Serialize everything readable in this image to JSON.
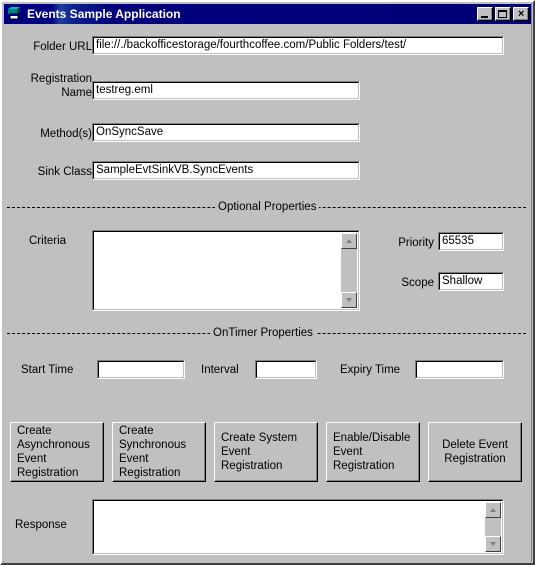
{
  "window": {
    "title": "Events Sample Application",
    "icon": "vb-form-icon",
    "controls": {
      "minimize": "_",
      "maximize": "□",
      "close": "×"
    }
  },
  "form": {
    "folder_url": {
      "label": "Folder URL",
      "value": "file://./backofficestorage/fourthcoffee.com/Public Folders/test/"
    },
    "registration_name": {
      "label": "Registration\nName",
      "value": "testreg.eml"
    },
    "methods": {
      "label": "Method(s)",
      "value": "OnSyncSave"
    },
    "sink_class": {
      "label": "Sink Class",
      "value": "SampleEvtSinkVB.SyncEvents"
    }
  },
  "optional_properties": {
    "caption": "Optional Properties",
    "criteria": {
      "label": "Criteria",
      "value": ""
    },
    "priority": {
      "label": "Priority",
      "value": "65535"
    },
    "scope": {
      "label": "Scope",
      "value": "Shallow"
    }
  },
  "ontimer_properties": {
    "caption": "OnTimer Properties",
    "start_time": {
      "label": "Start Time",
      "value": ""
    },
    "interval": {
      "label": "Interval",
      "value": ""
    },
    "expiry_time": {
      "label": "Expiry Time",
      "value": ""
    }
  },
  "buttons": [
    {
      "id": "create-async",
      "label": "Create\nAsynchronous\nEvent\nRegistration"
    },
    {
      "id": "create-sync",
      "label": "Create\nSynchronous\nEvent\nRegistration"
    },
    {
      "id": "create-system",
      "label": "Create System\nEvent\nRegistration"
    },
    {
      "id": "enable-disable",
      "label": "Enable/Disable\nEvent\nRegistration"
    },
    {
      "id": "delete",
      "label": "Delete Event\nRegistration"
    }
  ],
  "response": {
    "label": "Response",
    "value": ""
  }
}
